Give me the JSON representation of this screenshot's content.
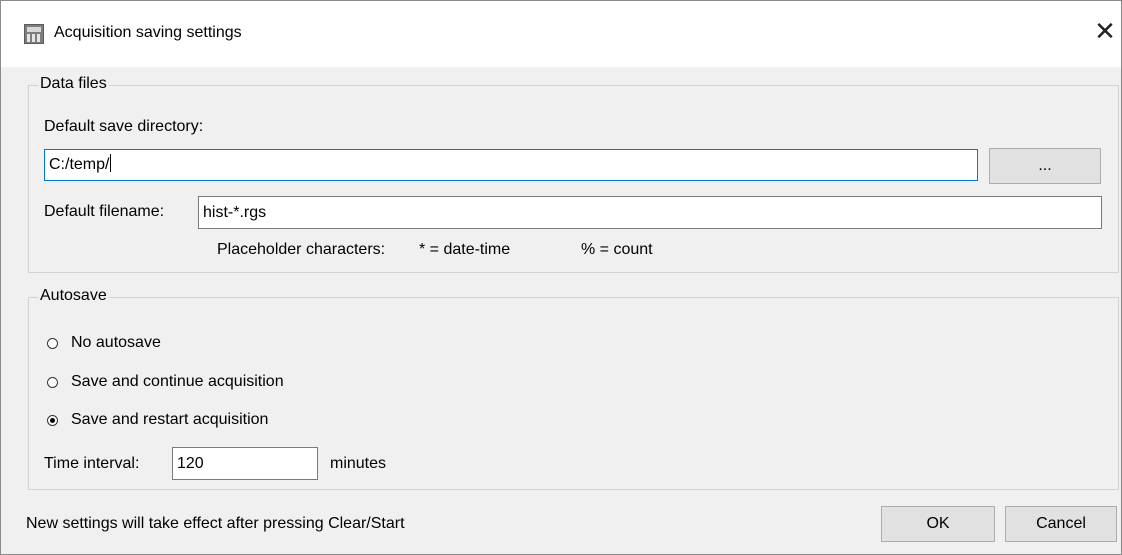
{
  "window": {
    "title": "Acquisition saving settings",
    "close_glyph": "✕",
    "app_icon": "app-icon"
  },
  "data_files": {
    "legend": "Data files",
    "directory_label": "Default save directory:",
    "directory_value": "C:/temp/",
    "browse_label": "...",
    "filename_label": "Default filename:",
    "filename_value": "hist-*.rgs",
    "placeholder_label": "Placeholder characters:",
    "placeholder_datetime": "* = date-time",
    "placeholder_count": "% = count"
  },
  "autosave": {
    "legend": "Autosave",
    "options": [
      {
        "label": "No autosave",
        "checked": false
      },
      {
        "label": "Save and continue acquisition",
        "checked": false
      },
      {
        "label": "Save and restart acquisition",
        "checked": true
      }
    ],
    "interval_label": "Time interval:",
    "interval_value": "120",
    "interval_unit": "minutes"
  },
  "footer": {
    "note": "New settings will take effect after pressing Clear/Start",
    "ok_label": "OK",
    "cancel_label": "Cancel"
  }
}
